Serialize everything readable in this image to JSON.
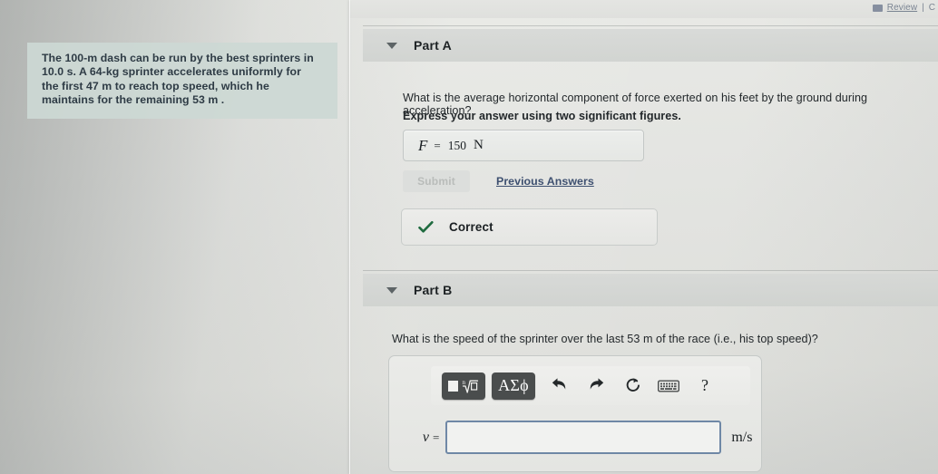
{
  "topbar": {
    "review_label": "Review",
    "separator": "|",
    "trailing_label": "C",
    "review_icon": "bookmark-icon"
  },
  "problem": {
    "line1": "The 100-m dash can be run by the best sprinters in",
    "line2": "10.0 s. A 64-kg sprinter accelerates uniformly for",
    "line3": "the first 47 m to reach top speed, which he",
    "line4": "maintains for the remaining 53 m ."
  },
  "parts": [
    {
      "label": "Part A",
      "caret_icon": "chevron-down-icon",
      "question": "What is the average horizontal component of force exerted on his feet by the ground during acceleration?",
      "instruction": "Express your answer using two significant figures.",
      "answer": {
        "variable": "F",
        "equals": "=",
        "value": "150",
        "unit": "N"
      },
      "submit_label": "Submit",
      "previous_answers_label": "Previous Answers",
      "feedback": {
        "icon": "checkmark-icon",
        "label": "Correct",
        "color": "#1f6b3f"
      }
    },
    {
      "label": "Part B",
      "caret_icon": "chevron-down-icon",
      "question": "What is the speed of the sprinter over the last 53 m of the race (i.e., his top speed)?",
      "toolbar": [
        {
          "name": "math-template-button",
          "label": "■√□",
          "icon": "math-template-icon"
        },
        {
          "name": "greek-symbols-button",
          "label": "ΑΣϕ",
          "icon": "greek-letters-icon"
        },
        {
          "name": "undo-button",
          "label": "",
          "icon": "undo-arrow-icon"
        },
        {
          "name": "redo-button",
          "label": "",
          "icon": "redo-arrow-icon"
        },
        {
          "name": "reset-button",
          "label": "",
          "icon": "reset-circular-arrow-icon"
        },
        {
          "name": "keyboard-button",
          "label": "",
          "icon": "keyboard-icon"
        },
        {
          "name": "help-button",
          "label": "?",
          "icon": "question-mark-icon"
        }
      ],
      "answer": {
        "variable": "v",
        "equals": "=",
        "value": "",
        "placeholder": "",
        "unit": "m/s"
      }
    }
  ],
  "colors": {
    "accent_link": "#3e5070",
    "input_border": "#6f88a6",
    "problem_highlight": "#ccd8d4",
    "correct_green": "#1f6b3f"
  }
}
